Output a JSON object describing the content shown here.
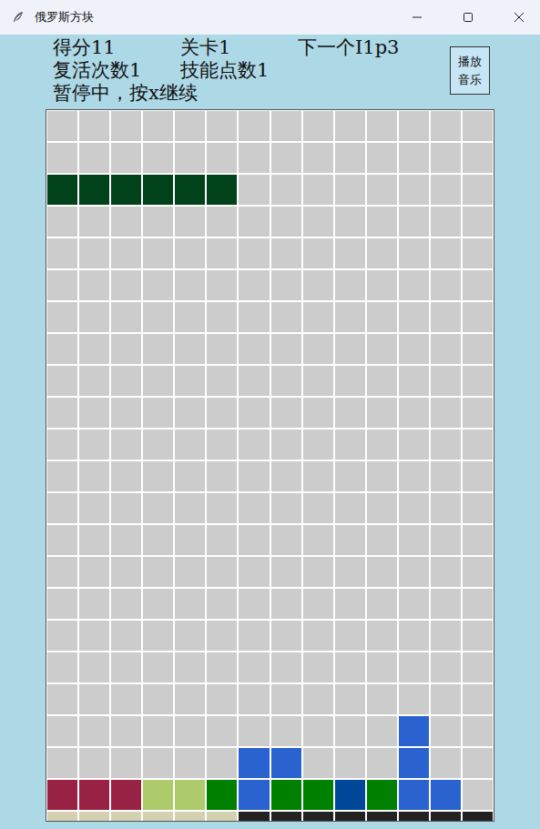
{
  "window": {
    "title": "俄罗斯方块"
  },
  "status": {
    "score": "得分11",
    "level": "关卡1",
    "next": "下一个I1p3",
    "lives": "复活次数1",
    "skill": "技能点数1",
    "paused": "暂停中，按x继续"
  },
  "music_button": {
    "label": "播放音乐"
  },
  "board": {
    "rows": [
      [
        null,
        null,
        null,
        null,
        null,
        null,
        null,
        null,
        null,
        null,
        null,
        null,
        null,
        null
      ],
      [
        null,
        null,
        null,
        null,
        null,
        null,
        null,
        null,
        null,
        null,
        null,
        null,
        null,
        null
      ],
      [
        "#00421a",
        "#00421a",
        "#00421a",
        "#00421a",
        "#00421a",
        "#00421a",
        null,
        null,
        null,
        null,
        null,
        null,
        null,
        null
      ],
      [
        null,
        null,
        null,
        null,
        null,
        null,
        null,
        null,
        null,
        null,
        null,
        null,
        null,
        null
      ],
      [
        null,
        null,
        null,
        null,
        null,
        null,
        null,
        null,
        null,
        null,
        null,
        null,
        null,
        null
      ],
      [
        null,
        null,
        null,
        null,
        null,
        null,
        null,
        null,
        null,
        null,
        null,
        null,
        null,
        null
      ],
      [
        null,
        null,
        null,
        null,
        null,
        null,
        null,
        null,
        null,
        null,
        null,
        null,
        null,
        null
      ],
      [
        null,
        null,
        null,
        null,
        null,
        null,
        null,
        null,
        null,
        null,
        null,
        null,
        null,
        null
      ],
      [
        null,
        null,
        null,
        null,
        null,
        null,
        null,
        null,
        null,
        null,
        null,
        null,
        null,
        null
      ],
      [
        null,
        null,
        null,
        null,
        null,
        null,
        null,
        null,
        null,
        null,
        null,
        null,
        null,
        null
      ],
      [
        null,
        null,
        null,
        null,
        null,
        null,
        null,
        null,
        null,
        null,
        null,
        null,
        null,
        null
      ],
      [
        null,
        null,
        null,
        null,
        null,
        null,
        null,
        null,
        null,
        null,
        null,
        null,
        null,
        null
      ],
      [
        null,
        null,
        null,
        null,
        null,
        null,
        null,
        null,
        null,
        null,
        null,
        null,
        null,
        null
      ],
      [
        null,
        null,
        null,
        null,
        null,
        null,
        null,
        null,
        null,
        null,
        null,
        null,
        null,
        null
      ],
      [
        null,
        null,
        null,
        null,
        null,
        null,
        null,
        null,
        null,
        null,
        null,
        null,
        null,
        null
      ],
      [
        null,
        null,
        null,
        null,
        null,
        null,
        null,
        null,
        null,
        null,
        null,
        null,
        null,
        null
      ],
      [
        null,
        null,
        null,
        null,
        null,
        null,
        null,
        null,
        null,
        null,
        null,
        null,
        null,
        null
      ],
      [
        null,
        null,
        null,
        null,
        null,
        null,
        null,
        null,
        null,
        null,
        null,
        null,
        null,
        null
      ],
      [
        null,
        null,
        null,
        null,
        null,
        null,
        null,
        null,
        null,
        null,
        null,
        null,
        null,
        null
      ],
      [
        null,
        null,
        null,
        null,
        null,
        null,
        null,
        null,
        null,
        null,
        null,
        "#2a62d0",
        null,
        null
      ],
      [
        null,
        null,
        null,
        null,
        null,
        null,
        "#2a62d0",
        "#2a62d0",
        null,
        null,
        null,
        "#2a62d0",
        null,
        null
      ],
      [
        "#982244",
        "#982244",
        "#982244",
        "#adcb6a",
        "#adcb6a",
        "#008000",
        "#2a62d0",
        "#008000",
        "#008000",
        "#00479a",
        "#008000",
        "#2a62d0",
        "#2a62d0",
        null
      ],
      [
        "#d4d1b3",
        "#d4d1b3",
        "#d4d1b3",
        "#d4d1b3",
        "#d4d1b3",
        "#d4d1b3",
        "#222222",
        "#222222",
        "#222222",
        "#222222",
        "#222222",
        "#222222",
        "#222222",
        "#222222"
      ]
    ]
  }
}
